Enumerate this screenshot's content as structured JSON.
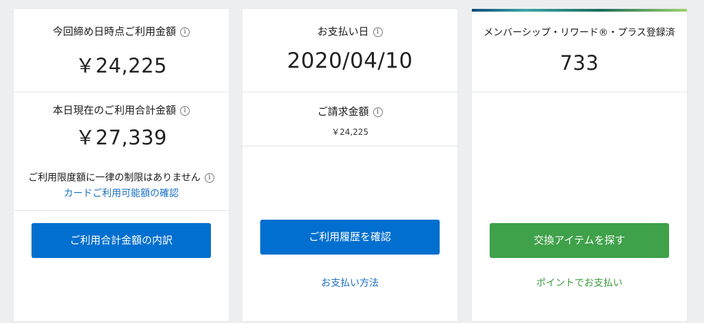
{
  "card_current": {
    "billing_label": "今回締め日時点ご利用金額",
    "billing_amount": "￥24,225",
    "today_label": "本日現在のご利用合計金額",
    "today_amount": "￥27,339",
    "limit_note": "ご利用限度額に一律の制限はありません",
    "limit_link": "カードご利用可能額の確認",
    "breakdown_button": "ご利用合計金額の内訳"
  },
  "card_payment": {
    "payment_date_label": "お支払い日",
    "payment_date": "2020/04/10",
    "billed_label": "ご請求金額",
    "billed_amount": "￥24,225",
    "history_button": "ご利用履歴を確認",
    "payment_method_link": "お支払い方法"
  },
  "card_rewards": {
    "program_label": "メンバーシップ・リワード®・プラス登録済",
    "points": "733",
    "exchange_button": "交換アイテムを探す",
    "pay_with_points_link": "ポイントでお支払い"
  },
  "icons": {
    "info": "info-icon",
    "info_glyph": "i"
  },
  "colors": {
    "primary_blue": "#006fcf",
    "link_blue": "#1a6fc4",
    "green": "#3fa14a",
    "background": "#eceef0"
  }
}
